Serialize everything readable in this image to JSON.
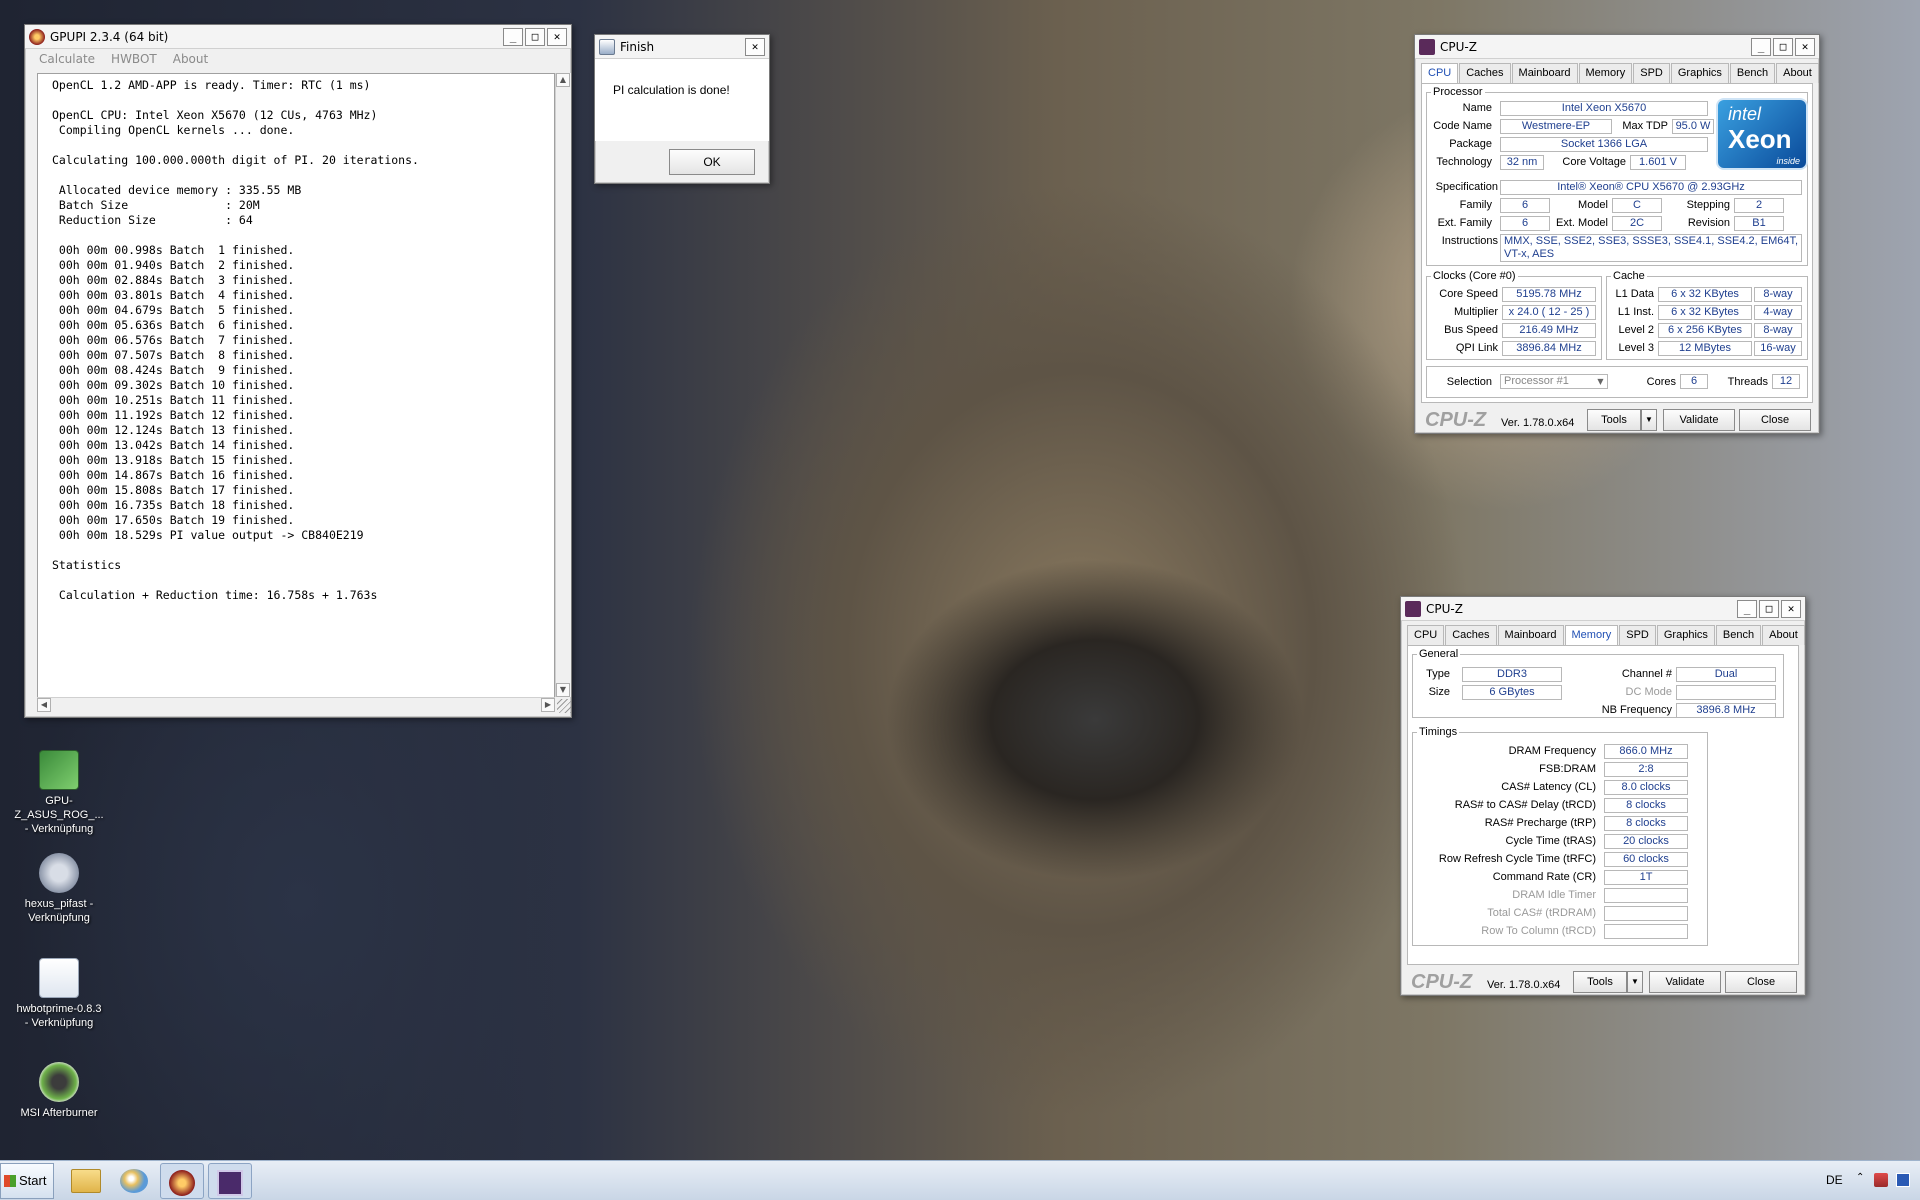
{
  "gpupi": {
    "title": "GPUPI 2.3.4 (64 bit)",
    "menu": [
      "Calculate",
      "HWBOT",
      "About"
    ],
    "output": "OpenCL 1.2 AMD-APP is ready. Timer: RTC (1 ms)\n\nOpenCL CPU: Intel Xeon X5670 (12 CUs, 4763 MHz)\n Compiling OpenCL kernels ... done.\n\nCalculating 100.000.000th digit of PI. 20 iterations.\n\n Allocated device memory : 335.55 MB\n Batch Size              : 20M\n Reduction Size          : 64\n\n 00h 00m 00.998s Batch  1 finished.\n 00h 00m 01.940s Batch  2 finished.\n 00h 00m 02.884s Batch  3 finished.\n 00h 00m 03.801s Batch  4 finished.\n 00h 00m 04.679s Batch  5 finished.\n 00h 00m 05.636s Batch  6 finished.\n 00h 00m 06.576s Batch  7 finished.\n 00h 00m 07.507s Batch  8 finished.\n 00h 00m 08.424s Batch  9 finished.\n 00h 00m 09.302s Batch 10 finished.\n 00h 00m 10.251s Batch 11 finished.\n 00h 00m 11.192s Batch 12 finished.\n 00h 00m 12.124s Batch 13 finished.\n 00h 00m 13.042s Batch 14 finished.\n 00h 00m 13.918s Batch 15 finished.\n 00h 00m 14.867s Batch 16 finished.\n 00h 00m 15.808s Batch 17 finished.\n 00h 00m 16.735s Batch 18 finished.\n 00h 00m 17.650s Batch 19 finished.\n 00h 00m 18.529s PI value output -> CB840E219\n\nStatistics\n\n Calculation + Reduction time: 16.758s + 1.763s"
  },
  "finish_dialog": {
    "title": "Finish",
    "message": "PI calculation is done!",
    "ok_label": "OK"
  },
  "cpuz_cpu": {
    "title": "CPU-Z",
    "tabs": [
      "CPU",
      "Caches",
      "Mainboard",
      "Memory",
      "SPD",
      "Graphics",
      "Bench",
      "About"
    ],
    "processor_legend": "Processor",
    "labels": {
      "name": "Name",
      "code_name": "Code Name",
      "max_tdp": "Max TDP",
      "package": "Package",
      "technology": "Technology",
      "core_voltage": "Core Voltage",
      "specification": "Specification",
      "family": "Family",
      "model": "Model",
      "stepping": "Stepping",
      "ext_family": "Ext. Family",
      "ext_model": "Ext. Model",
      "revision": "Revision",
      "instructions": "Instructions"
    },
    "values": {
      "name": "Intel Xeon X5670",
      "code_name": "Westmere-EP",
      "max_tdp": "95.0 W",
      "package": "Socket 1366 LGA",
      "technology": "32 nm",
      "core_voltage": "1.601 V",
      "specification": "Intel® Xeon® CPU           X5670  @ 2.93GHz",
      "family": "6",
      "model": "C",
      "stepping": "2",
      "ext_family": "6",
      "ext_model": "2C",
      "revision": "B1",
      "instructions": "MMX, SSE, SSE2, SSE3, SSSE3, SSE4.1, SSE4.2, EM64T, VT-x, AES"
    },
    "logo": {
      "brand": "intel",
      "product": "Xeon",
      "tag": "inside"
    },
    "clocks": {
      "legend": "Clocks (Core #0)",
      "labels": [
        "Core Speed",
        "Multiplier",
        "Bus Speed",
        "QPI Link"
      ],
      "values": [
        "5195.78 MHz",
        "x 24.0 ( 12 - 25 )",
        "216.49 MHz",
        "3896.84 MHz"
      ]
    },
    "cache": {
      "legend": "Cache",
      "labels": [
        "L1 Data",
        "L1 Inst.",
        "Level 2",
        "Level 3"
      ],
      "sizes": [
        "6 x 32 KBytes",
        "6 x 32 KBytes",
        "6 x 256 KBytes",
        "12 MBytes"
      ],
      "ways": [
        "8-way",
        "4-way",
        "8-way",
        "16-way"
      ]
    },
    "selection_label": "Selection",
    "selection_value": "Processor #1",
    "cores_label": "Cores",
    "cores_value": "6",
    "threads_label": "Threads",
    "threads_value": "12",
    "brand": "CPU-Z",
    "version": "Ver. 1.78.0.x64",
    "tools_label": "Tools",
    "validate_label": "Validate",
    "close_label": "Close"
  },
  "cpuz_mem": {
    "title": "CPU-Z",
    "tabs": [
      "CPU",
      "Caches",
      "Mainboard",
      "Memory",
      "SPD",
      "Graphics",
      "Bench",
      "About"
    ],
    "general_legend": "General",
    "type_label": "Type",
    "type_value": "DDR3",
    "size_label": "Size",
    "size_value": "6 GBytes",
    "channel_label": "Channel #",
    "channel_value": "Dual",
    "dcmode_label": "DC Mode",
    "dcmode_value": "",
    "nbfreq_label": "NB Frequency",
    "nbfreq_value": "3896.8 MHz",
    "timings_legend": "Timings",
    "timings": [
      {
        "label": "DRAM Frequency",
        "value": "866.0 MHz",
        "disabled": false
      },
      {
        "label": "FSB:DRAM",
        "value": "2:8",
        "disabled": false
      },
      {
        "label": "CAS# Latency (CL)",
        "value": "8.0 clocks",
        "disabled": false
      },
      {
        "label": "RAS# to CAS# Delay (tRCD)",
        "value": "8 clocks",
        "disabled": false
      },
      {
        "label": "RAS# Precharge (tRP)",
        "value": "8 clocks",
        "disabled": false
      },
      {
        "label": "Cycle Time (tRAS)",
        "value": "20 clocks",
        "disabled": false
      },
      {
        "label": "Row Refresh Cycle Time (tRFC)",
        "value": "60 clocks",
        "disabled": false
      },
      {
        "label": "Command Rate (CR)",
        "value": "1T",
        "disabled": false
      },
      {
        "label": "DRAM Idle Timer",
        "value": "",
        "disabled": true
      },
      {
        "label": "Total CAS# (tRDRAM)",
        "value": "",
        "disabled": true
      },
      {
        "label": "Row To Column (tRCD)",
        "value": "",
        "disabled": true
      }
    ],
    "brand": "CPU-Z",
    "version": "Ver. 1.78.0.x64",
    "tools_label": "Tools",
    "validate_label": "Validate",
    "close_label": "Close"
  },
  "desktop_icons": [
    {
      "label": "GPU-Z_ASUS_ROG_... - Verknüpfung"
    },
    {
      "label": "hexus_pifast - Verknüpfung"
    },
    {
      "label": "hwbotprime-0.8.3 - Verknüpfung"
    },
    {
      "label": "MSI Afterburner"
    }
  ],
  "taskbar": {
    "start_label": "Start",
    "language": "DE"
  },
  "colors": {
    "accent": "#1f4fb4",
    "value_text": "#1f3f8f"
  }
}
